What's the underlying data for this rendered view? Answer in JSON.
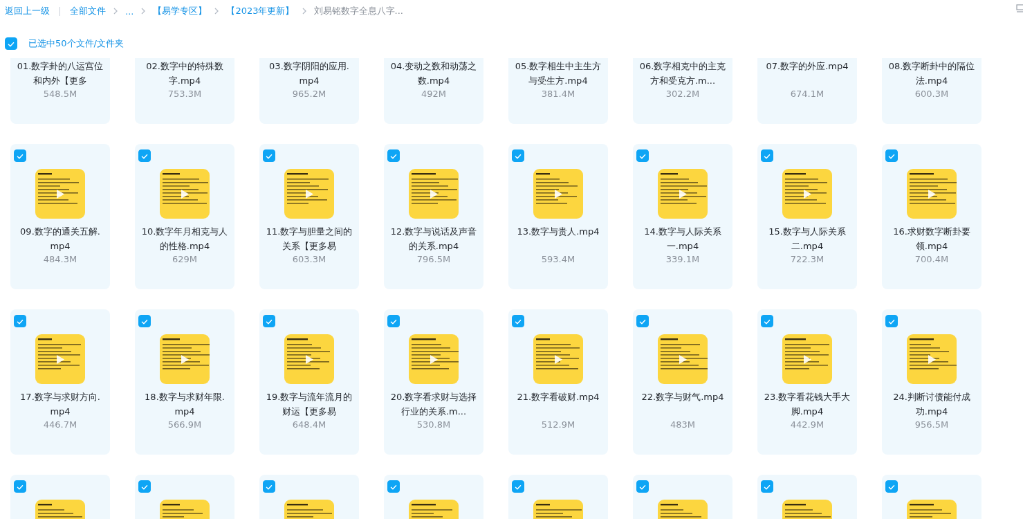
{
  "breadcrumb": {
    "back": "返回上一级",
    "items": [
      {
        "label": "全部文件",
        "current": false
      },
      {
        "label": "...",
        "current": false
      },
      {
        "label": "【易学专区】",
        "current": false
      },
      {
        "label": "【2023年更新】",
        "current": false
      },
      {
        "label": "刘易铭数字全息八字...",
        "current": true
      }
    ]
  },
  "selection": {
    "checked": true,
    "label": "已选中50个文件/文件夹"
  },
  "files": [
    {
      "name": "01.数字卦的八运宫位和内外【更多",
      "size": "548.5M"
    },
    {
      "name": "02.数字中的特殊数字.mp4",
      "size": "753.3M"
    },
    {
      "name": "03.数字阴阳的应用.mp4",
      "size": "965.2M"
    },
    {
      "name": "04.变动之数和动荡之数.mp4",
      "size": "492M"
    },
    {
      "name": "05.数字相生中主生方与受生方.mp4",
      "size": "381.4M"
    },
    {
      "name": "06.数字相克中的主克方和受克方.m...",
      "size": "302.2M"
    },
    {
      "name": "07.数字的外应.mp4",
      "size": "674.1M"
    },
    {
      "name": "08.数字断卦中的隔位法.mp4",
      "size": "600.3M"
    },
    {
      "name": "09.数字的通关五解.mp4",
      "size": "484.3M",
      "checked": true
    },
    {
      "name": "10.数字年月相克与人的性格.mp4",
      "size": "629M",
      "checked": true
    },
    {
      "name": "11.数字与胆量之间的关系【更多易",
      "size": "603.3M",
      "checked": true
    },
    {
      "name": "12.数字与说话及声音的关系.mp4",
      "size": "796.5M",
      "checked": true
    },
    {
      "name": "13.数字与贵人.mp4",
      "size": "593.4M",
      "checked": true
    },
    {
      "name": "14.数字与人际关系一.mp4",
      "size": "339.1M",
      "checked": true
    },
    {
      "name": "15.数字与人际关系二.mp4",
      "size": "722.3M",
      "checked": true
    },
    {
      "name": "16.求财数字断卦要领.mp4",
      "size": "700.4M",
      "checked": true
    },
    {
      "name": "17.数字与求财方向.mp4",
      "size": "446.7M",
      "checked": true
    },
    {
      "name": "18.数字与求财年限.mp4",
      "size": "566.9M",
      "checked": true
    },
    {
      "name": "19.数字与流年流月的财运【更多易",
      "size": "648.4M",
      "checked": true
    },
    {
      "name": "20.数字看求财与选择行业的关系.m...",
      "size": "530.8M",
      "checked": true
    },
    {
      "name": "21.数字看破财.mp4",
      "size": "512.9M",
      "checked": true
    },
    {
      "name": "22.数字与财气.mp4",
      "size": "483M",
      "checked": true
    },
    {
      "name": "23.数字看花钱大手大脚.mp4",
      "size": "442.9M",
      "checked": true
    },
    {
      "name": "24.判断讨债能付成功.mp4",
      "size": "956.5M",
      "checked": true
    },
    {
      "checked": true
    },
    {
      "checked": true
    },
    {
      "checked": true
    },
    {
      "checked": true
    },
    {
      "checked": true
    },
    {
      "checked": true
    },
    {
      "checked": true
    },
    {
      "checked": true
    }
  ]
}
